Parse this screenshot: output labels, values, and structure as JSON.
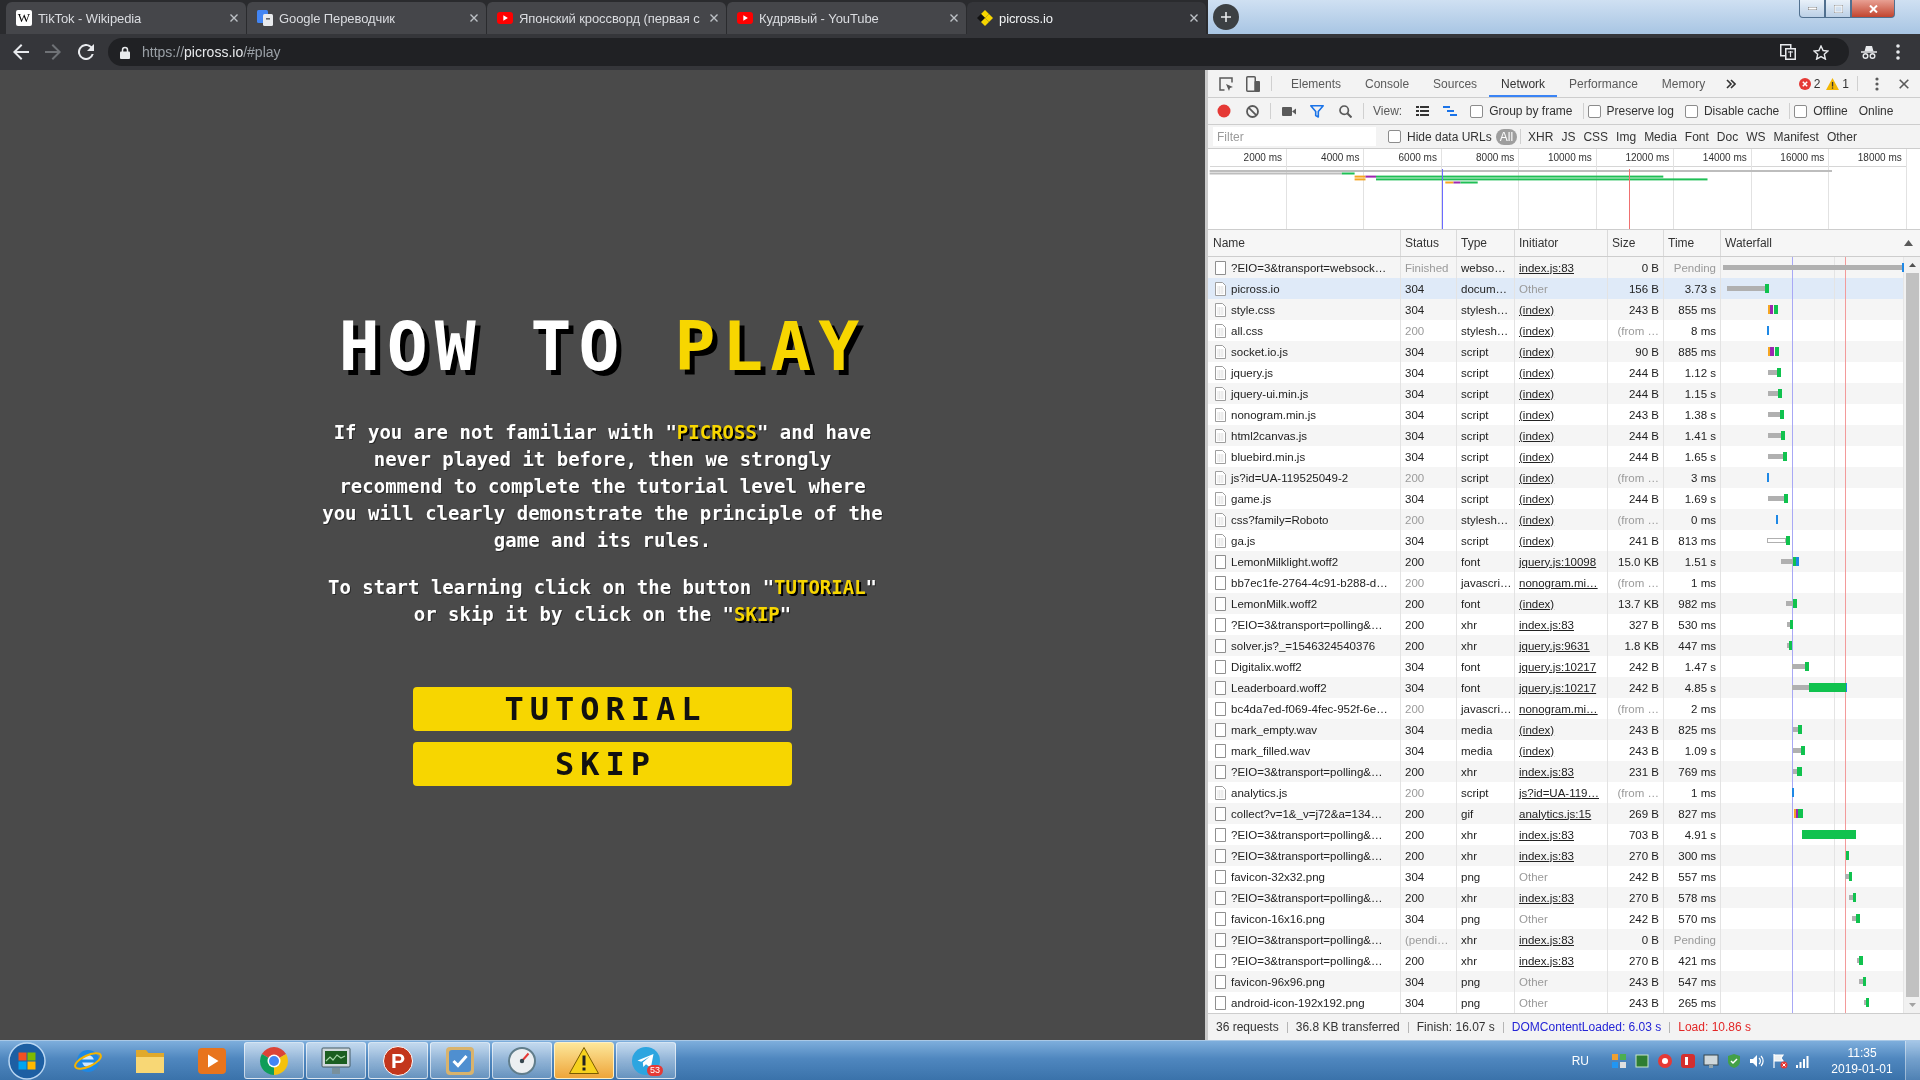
{
  "browser": {
    "tabs": [
      {
        "title": "TikTok - Wikipedia",
        "kind": "letter",
        "glyph": "W",
        "selected": false
      },
      {
        "title": "Google Переводчик",
        "kind": "translate",
        "selected": false
      },
      {
        "title": "Японский кроссворд (первая с",
        "kind": "video",
        "selected": false
      },
      {
        "title": "Кудрявый - YouTube",
        "kind": "video",
        "selected": false
      },
      {
        "title": "picross.io",
        "kind": "puzzle",
        "selected": true
      }
    ],
    "back_enabled": true,
    "forward_enabled": false,
    "url": "https://**picross.io**/#play"
  },
  "page": {
    "title": "HOW TO **PLAY**",
    "paragraphs": [
      "If you are not familiar with \"**PICROSS**\" and have never played it before, then we strongly recommend to complete the tutorial level where you will clearly demonstrate the principle of the game and its rules.",
      "To start learning click on the button \"**TUTORIAL**\" or skip it by click on the \"**SKIP**\""
    ],
    "buttons": [
      "TUTORIAL",
      "SKIP"
    ]
  },
  "devtools": {
    "tabs": [
      {
        "label": "Elements",
        "selected": false
      },
      {
        "label": "Console",
        "selected": false
      },
      {
        "label": "Sources",
        "selected": false
      },
      {
        "label": "Network",
        "selected": true
      },
      {
        "label": "Performance",
        "selected": false
      },
      {
        "label": "Memory",
        "selected": false
      }
    ],
    "errors": "2",
    "warnings": "1",
    "toolbar": {
      "recording": true,
      "filter_shown": true,
      "view_label": "View:",
      "large_rows": false,
      "overview_shown": true,
      "option_groups": [
        [
          {
            "label": "Group by frame",
            "checked": false
          }
        ],
        [
          {
            "label": "Preserve log",
            "checked": false
          },
          {
            "label": "Disable cache",
            "checked": false
          }
        ],
        [
          {
            "label": "Offline",
            "checked": false
          }
        ]
      ],
      "throttling": "Online"
    },
    "filter": {
      "placeholder": "Filter",
      "hide_data_urls": {
        "label": "Hide data URLs",
        "checked": false
      },
      "types": [
        {
          "label": "All",
          "selected": true
        },
        {
          "label": "XHR",
          "selected": false
        },
        {
          "label": "JS",
          "selected": false
        },
        {
          "label": "CSS",
          "selected": false
        },
        {
          "label": "Img",
          "selected": false
        },
        {
          "label": "Media",
          "selected": false
        },
        {
          "label": "Font",
          "selected": false
        },
        {
          "label": "Doc",
          "selected": false
        },
        {
          "label": "WS",
          "selected": false
        },
        {
          "label": "Manifest",
          "selected": false
        },
        {
          "label": "Other",
          "selected": false
        }
      ]
    },
    "overview": {
      "ticks": [
        "2000 ms",
        "4000 ms",
        "6000 ms",
        "8000 ms",
        "10000 ms",
        "12000 ms",
        "14000 ms",
        "16000 ms",
        "18000 ms"
      ]
    },
    "columns": [
      "Name",
      "Status",
      "Type",
      "Initiator",
      "Size",
      "Time",
      "Waterfall"
    ],
    "rows": [
      {
        "name": "?EIO=3&transport=websock…",
        "status": "Finished",
        "type": "webso…",
        "initiator": "index.js:83",
        "size": "0 B",
        "time": "Pending",
        "kind": "plain",
        "initiator_link": true,
        "cached": false,
        "pending": true,
        "selected": false
      },
      {
        "name": "picross.io",
        "status": "304",
        "type": "docum…",
        "initiator": "Other",
        "size": "156 B",
        "time": "3.73 s",
        "kind": "text",
        "initiator_link": false,
        "cached": false,
        "pending": false,
        "selected": true
      },
      {
        "name": "style.css",
        "status": "304",
        "type": "stylesh…",
        "initiator": "(index)",
        "size": "243 B",
        "time": "855 ms",
        "kind": "text",
        "initiator_link": true,
        "cached": false,
        "pending": false,
        "selected": false
      },
      {
        "name": "all.css",
        "status": "200",
        "type": "stylesh…",
        "initiator": "(index)",
        "size": "(from …",
        "time": "8 ms",
        "kind": "text",
        "initiator_link": true,
        "cached": true,
        "pending": false,
        "selected": false
      },
      {
        "name": "socket.io.js",
        "status": "304",
        "type": "script",
        "initiator": "(index)",
        "size": "90 B",
        "time": "885 ms",
        "kind": "text",
        "initiator_link": true,
        "cached": false,
        "pending": false,
        "selected": false
      },
      {
        "name": "jquery.js",
        "status": "304",
        "type": "script",
        "initiator": "(index)",
        "size": "244 B",
        "time": "1.12 s",
        "kind": "text",
        "initiator_link": true,
        "cached": false,
        "pending": false,
        "selected": false
      },
      {
        "name": "jquery-ui.min.js",
        "status": "304",
        "type": "script",
        "initiator": "(index)",
        "size": "244 B",
        "time": "1.15 s",
        "kind": "text",
        "initiator_link": true,
        "cached": false,
        "pending": false,
        "selected": false
      },
      {
        "name": "nonogram.min.js",
        "status": "304",
        "type": "script",
        "initiator": "(index)",
        "size": "243 B",
        "time": "1.38 s",
        "kind": "text",
        "initiator_link": true,
        "cached": false,
        "pending": false,
        "selected": false
      },
      {
        "name": "html2canvas.js",
        "status": "304",
        "type": "script",
        "initiator": "(index)",
        "size": "244 B",
        "time": "1.41 s",
        "kind": "text",
        "initiator_link": true,
        "cached": false,
        "pending": false,
        "selected": false
      },
      {
        "name": "bluebird.min.js",
        "status": "304",
        "type": "script",
        "initiator": "(index)",
        "size": "244 B",
        "time": "1.65 s",
        "kind": "text",
        "initiator_link": true,
        "cached": false,
        "pending": false,
        "selected": false
      },
      {
        "name": "js?id=UA-119525049-2",
        "status": "200",
        "type": "script",
        "initiator": "(index)",
        "size": "(from …",
        "time": "3 ms",
        "kind": "text",
        "initiator_link": true,
        "cached": true,
        "pending": false,
        "selected": false
      },
      {
        "name": "game.js",
        "status": "304",
        "type": "script",
        "initiator": "(index)",
        "size": "244 B",
        "time": "1.69 s",
        "kind": "text",
        "initiator_link": true,
        "cached": false,
        "pending": false,
        "selected": false
      },
      {
        "name": "css?family=Roboto",
        "status": "200",
        "type": "stylesh…",
        "initiator": "(index)",
        "size": "(from …",
        "time": "0 ms",
        "kind": "text",
        "initiator_link": true,
        "cached": true,
        "pending": false,
        "selected": false
      },
      {
        "name": "ga.js",
        "status": "304",
        "type": "script",
        "initiator": "(index)",
        "size": "241 B",
        "time": "813 ms",
        "kind": "text",
        "initiator_link": true,
        "cached": false,
        "pending": false,
        "selected": false
      },
      {
        "name": "LemonMilklight.woff2",
        "status": "200",
        "type": "font",
        "initiator": "jquery.js:10098",
        "size": "15.0 KB",
        "time": "1.51 s",
        "kind": "plain",
        "initiator_link": true,
        "cached": false,
        "pending": false,
        "selected": false
      },
      {
        "name": "bb7ec1fe-2764-4c91-b288-d…",
        "status": "200",
        "type": "javascri…",
        "initiator": "nonogram.mi…",
        "size": "(from …",
        "time": "1 ms",
        "kind": "plain",
        "initiator_link": true,
        "cached": true,
        "pending": false,
        "selected": false
      },
      {
        "name": "LemonMilk.woff2",
        "status": "200",
        "type": "font",
        "initiator": "(index)",
        "size": "13.7 KB",
        "time": "982 ms",
        "kind": "plain",
        "initiator_link": true,
        "cached": false,
        "pending": false,
        "selected": false
      },
      {
        "name": "?EIO=3&transport=polling&…",
        "status": "200",
        "type": "xhr",
        "initiator": "index.js:83",
        "size": "327 B",
        "time": "530 ms",
        "kind": "plain",
        "initiator_link": true,
        "cached": false,
        "pending": false,
        "selected": false
      },
      {
        "name": "solver.js?_=1546324540376",
        "status": "200",
        "type": "xhr",
        "initiator": "jquery.js:9631",
        "size": "1.8 KB",
        "time": "447 ms",
        "kind": "plain",
        "initiator_link": true,
        "cached": false,
        "pending": false,
        "selected": false
      },
      {
        "name": "Digitalix.woff2",
        "status": "304",
        "type": "font",
        "initiator": "jquery.js:10217",
        "size": "242 B",
        "time": "1.47 s",
        "kind": "plain",
        "initiator_link": true,
        "cached": false,
        "pending": false,
        "selected": false
      },
      {
        "name": "Leaderboard.woff2",
        "status": "304",
        "type": "font",
        "initiator": "jquery.js:10217",
        "size": "242 B",
        "time": "4.85 s",
        "kind": "plain",
        "initiator_link": true,
        "cached": false,
        "pending": false,
        "selected": false
      },
      {
        "name": "bc4da7ed-f069-4fec-952f-6e…",
        "status": "200",
        "type": "javascri…",
        "initiator": "nonogram.mi…",
        "size": "(from …",
        "time": "2 ms",
        "kind": "plain",
        "initiator_link": true,
        "cached": true,
        "pending": false,
        "selected": false
      },
      {
        "name": "mark_empty.wav",
        "status": "304",
        "type": "media",
        "initiator": "(index)",
        "size": "243 B",
        "time": "825 ms",
        "kind": "plain",
        "initiator_link": true,
        "cached": false,
        "pending": false,
        "selected": false
      },
      {
        "name": "mark_filled.wav",
        "status": "304",
        "type": "media",
        "initiator": "(index)",
        "size": "243 B",
        "time": "1.09 s",
        "kind": "plain",
        "initiator_link": true,
        "cached": false,
        "pending": false,
        "selected": false
      },
      {
        "name": "?EIO=3&transport=polling&…",
        "status": "200",
        "type": "xhr",
        "initiator": "index.js:83",
        "size": "231 B",
        "time": "769 ms",
        "kind": "plain",
        "initiator_link": true,
        "cached": false,
        "pending": false,
        "selected": false
      },
      {
        "name": "analytics.js",
        "status": "200",
        "type": "script",
        "initiator": "js?id=UA-119…",
        "size": "(from …",
        "time": "1 ms",
        "kind": "text",
        "initiator_link": true,
        "cached": true,
        "pending": false,
        "selected": false
      },
      {
        "name": "collect?v=1&_v=j72&a=134…",
        "status": "200",
        "type": "gif",
        "initiator": "analytics.js:15",
        "size": "269 B",
        "time": "827 ms",
        "kind": "plain",
        "initiator_link": true,
        "cached": false,
        "pending": false,
        "selected": false
      },
      {
        "name": "?EIO=3&transport=polling&…",
        "status": "200",
        "type": "xhr",
        "initiator": "index.js:83",
        "size": "703 B",
        "time": "4.91 s",
        "kind": "plain",
        "initiator_link": true,
        "cached": false,
        "pending": false,
        "selected": false
      },
      {
        "name": "?EIO=3&transport=polling&…",
        "status": "200",
        "type": "xhr",
        "initiator": "index.js:83",
        "size": "270 B",
        "time": "300 ms",
        "kind": "plain",
        "initiator_link": true,
        "cached": false,
        "pending": false,
        "selected": false
      },
      {
        "name": "favicon-32x32.png",
        "status": "304",
        "type": "png",
        "initiator": "Other",
        "size": "242 B",
        "time": "557 ms",
        "kind": "plain",
        "initiator_link": false,
        "cached": false,
        "pending": false,
        "selected": false
      },
      {
        "name": "?EIO=3&transport=polling&…",
        "status": "200",
        "type": "xhr",
        "initiator": "index.js:83",
        "size": "270 B",
        "time": "578 ms",
        "kind": "plain",
        "initiator_link": true,
        "cached": false,
        "pending": false,
        "selected": false
      },
      {
        "name": "favicon-16x16.png",
        "status": "304",
        "type": "png",
        "initiator": "Other",
        "size": "242 B",
        "time": "570 ms",
        "kind": "plain",
        "initiator_link": false,
        "cached": false,
        "pending": false,
        "selected": false
      },
      {
        "name": "?EIO=3&transport=polling&…",
        "status": "(pendi…",
        "type": "xhr",
        "initiator": "index.js:83",
        "size": "0 B",
        "time": "Pending",
        "kind": "plain",
        "initiator_link": true,
        "cached": false,
        "pending": true,
        "selected": false
      },
      {
        "name": "?EIO=3&transport=polling&…",
        "status": "200",
        "type": "xhr",
        "initiator": "index.js:83",
        "size": "270 B",
        "time": "421 ms",
        "kind": "plain",
        "initiator_link": true,
        "cached": false,
        "pending": false,
        "selected": false
      },
      {
        "name": "favicon-96x96.png",
        "status": "304",
        "type": "png",
        "initiator": "Other",
        "size": "243 B",
        "time": "547 ms",
        "kind": "plain",
        "initiator_link": false,
        "cached": false,
        "pending": false,
        "selected": false
      },
      {
        "name": "android-icon-192x192.png",
        "status": "304",
        "type": "png",
        "initiator": "Other",
        "size": "243 B",
        "time": "265 ms",
        "kind": "plain",
        "initiator_link": false,
        "cached": false,
        "pending": false,
        "selected": false
      }
    ],
    "summary": [
      {
        "text": "36 requests",
        "color": "#333333"
      },
      {
        "text": "36.8 KB transferred",
        "color": "#333333"
      },
      {
        "text": "Finish: 16.07 s",
        "color": "#333333"
      },
      {
        "text": "DOMContentLoaded: 6.03 s",
        "color": "#2424d6"
      },
      {
        "text": "Load: 10.86 s",
        "color": "#e32626"
      }
    ]
  },
  "taskbar": {
    "apps": [
      {
        "kind": "globe",
        "running": false,
        "flashing": false
      },
      {
        "kind": "folder",
        "running": false,
        "flashing": false
      },
      {
        "kind": "player",
        "running": false,
        "flashing": false
      },
      {
        "kind": "wheel",
        "running": true,
        "flashing": false
      },
      {
        "kind": "monitor",
        "running": true,
        "flashing": false
      },
      {
        "kind": "letter",
        "glyph": "P",
        "running": true,
        "flashing": false
      },
      {
        "kind": "tile",
        "running": true,
        "flashing": false
      },
      {
        "kind": "gauge",
        "running": true,
        "flashing": false
      },
      {
        "kind": "warning",
        "running": true,
        "flashing": true
      },
      {
        "kind": "plane",
        "badge": "53",
        "running": true,
        "flashing": false
      }
    ],
    "language": "RU",
    "time": "11:35",
    "date": "2019-01-01"
  }
}
